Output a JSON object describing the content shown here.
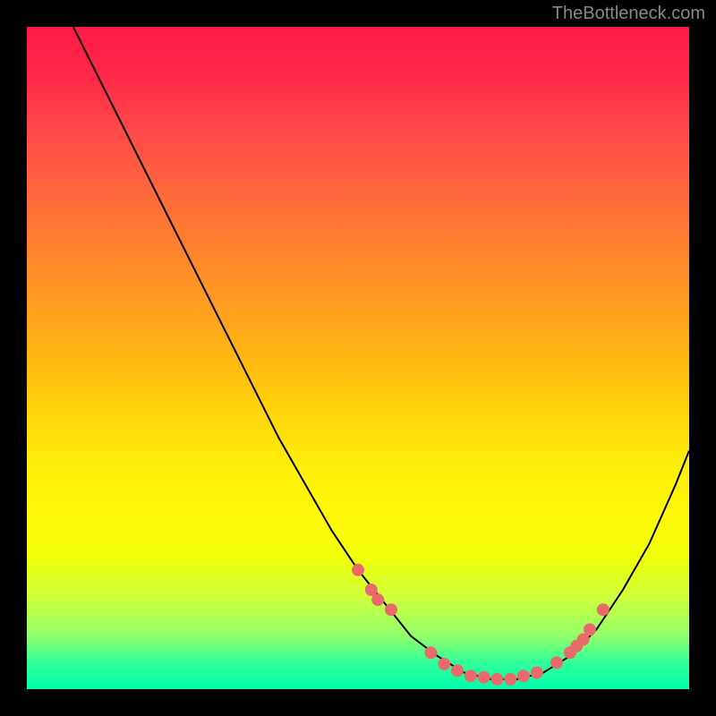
{
  "watermark": "TheBottleneck.com",
  "chart_data": {
    "type": "line",
    "title": "",
    "xlabel": "",
    "ylabel": "",
    "xlim": [
      0,
      100
    ],
    "ylim": [
      0,
      100
    ],
    "curve": {
      "x": [
        7,
        10,
        14,
        18,
        22,
        26,
        30,
        34,
        38,
        42,
        46,
        50,
        54,
        58,
        62,
        66,
        70,
        74,
        78,
        82,
        86,
        90,
        94,
        98,
        100
      ],
      "y": [
        100,
        94,
        86,
        78,
        70,
        62,
        54,
        46,
        38,
        31,
        24,
        18,
        13,
        8,
        5,
        2.5,
        1.5,
        1.5,
        2.5,
        5,
        9,
        15,
        22,
        31,
        36
      ]
    },
    "points": [
      {
        "x": 50,
        "y": 18
      },
      {
        "x": 52,
        "y": 15
      },
      {
        "x": 53,
        "y": 13.5
      },
      {
        "x": 55,
        "y": 12
      },
      {
        "x": 61,
        "y": 5.5
      },
      {
        "x": 63,
        "y": 3.8
      },
      {
        "x": 65,
        "y": 2.8
      },
      {
        "x": 67,
        "y": 2
      },
      {
        "x": 69,
        "y": 1.8
      },
      {
        "x": 71,
        "y": 1.5
      },
      {
        "x": 73,
        "y": 1.5
      },
      {
        "x": 75,
        "y": 2
      },
      {
        "x": 77,
        "y": 2.5
      },
      {
        "x": 80,
        "y": 4
      },
      {
        "x": 82,
        "y": 5.5
      },
      {
        "x": 83,
        "y": 6.5
      },
      {
        "x": 84,
        "y": 7.5
      },
      {
        "x": 85,
        "y": 9
      },
      {
        "x": 87,
        "y": 12
      }
    ],
    "point_color": "#e86a6a",
    "curve_color": "#000000"
  }
}
